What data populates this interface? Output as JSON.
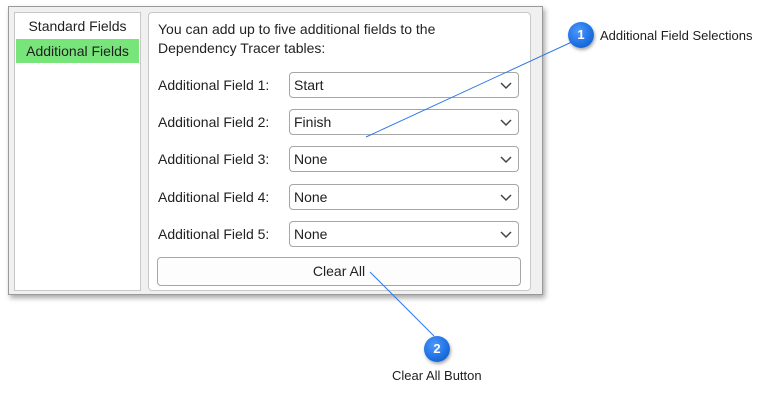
{
  "sidebar": {
    "items": [
      {
        "label": "Standard Fields"
      },
      {
        "label": "Additional Fields"
      }
    ],
    "selected_color": "#77e57a"
  },
  "panel": {
    "intro": "You can add up to five additional fields to the Dependency Tracer tables:",
    "fields": [
      {
        "label": "Additional Field 1:",
        "value": "Start"
      },
      {
        "label": "Additional Field 2:",
        "value": "Finish"
      },
      {
        "label": "Additional Field 3:",
        "value": "None"
      },
      {
        "label": "Additional Field 4:",
        "value": "None"
      },
      {
        "label": "Additional Field 5:",
        "value": "None"
      }
    ],
    "clear_label": "Clear All"
  },
  "callouts": [
    {
      "number": "1",
      "label": "Additional Field Selections"
    },
    {
      "number": "2",
      "label": "Clear All Button"
    }
  ],
  "colors": {
    "callout_blue": "#1b6fe0",
    "leader_line": "#2e7be6"
  },
  "icons": {
    "dropdown": "chevron-down-icon"
  }
}
